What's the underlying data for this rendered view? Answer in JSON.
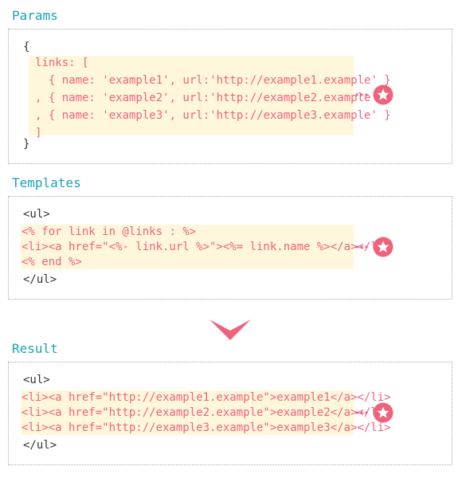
{
  "params": {
    "heading": "Params",
    "lines": [
      "{",
      "links: [",
      "  { name: 'example1', url:'http://example1.example' }",
      ", { name: 'example2', url:'http://example2.example' }",
      ", { name: 'example3', url:'http://example3.example' }",
      "]",
      "}"
    ]
  },
  "templates": {
    "heading": "Templates",
    "lines": [
      "<ul>",
      "<% for link in @links : %>",
      "<li><a href=\"<%- link.url %>\"><%= link.name %></a></li>",
      "<% end %>",
      "</ul>"
    ]
  },
  "result": {
    "heading": "Result",
    "lines": [
      "<ul>",
      "<li><a href=\"http://example1.example\">example1</a></li>",
      "<li><a href=\"http://example2.example\">example2</a></li>",
      "<li><a href=\"http://example3.example\">example3</a></li>",
      "</ul>"
    ]
  },
  "colors": {
    "heading": "#1aa3b6",
    "highlight_bg": "#fff7dc",
    "code_highlight": "#f0627b",
    "code_plain": "#333333",
    "badge": "#f0627b"
  },
  "icons": {
    "badge": "star-icon",
    "connector": "dotted-connector",
    "flow": "chevron-down-icon"
  }
}
